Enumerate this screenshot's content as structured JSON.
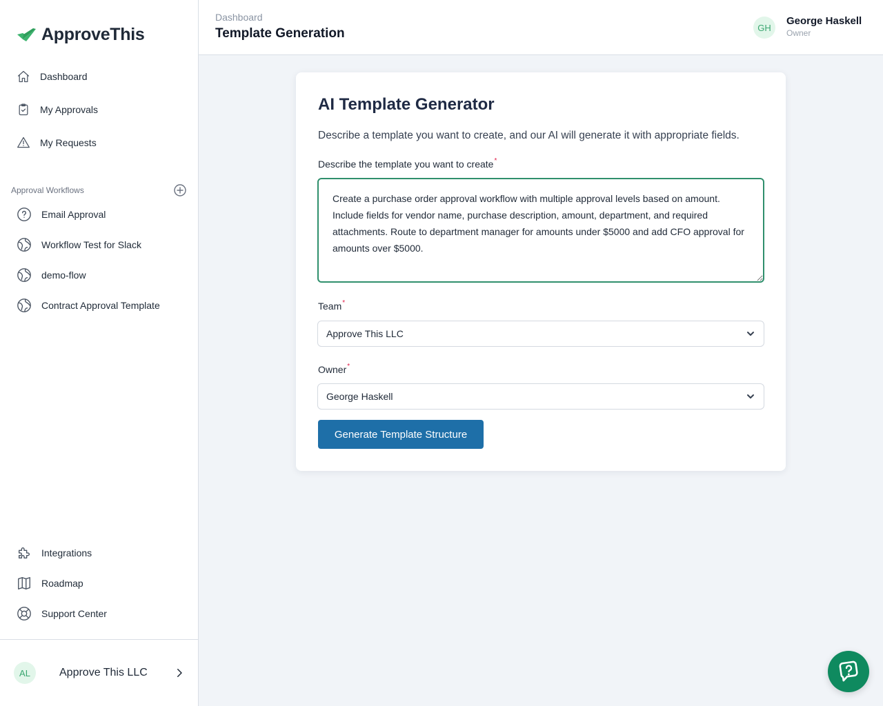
{
  "app": {
    "name": "ApproveThis",
    "brand_color": "#3cb46e",
    "accent_color": "#1e6fa8"
  },
  "sidebar": {
    "main_nav": [
      {
        "label": "Dashboard",
        "icon": "home-icon"
      },
      {
        "label": "My Approvals",
        "icon": "clipboard-check-icon"
      },
      {
        "label": "My Requests",
        "icon": "warning-triangle-icon"
      }
    ],
    "workflows_title": "Approval Workflows",
    "workflows": [
      {
        "label": "Email Approval",
        "icon": "question-circle-icon"
      },
      {
        "label": "Workflow Test for Slack",
        "icon": "globe-icon"
      },
      {
        "label": "demo-flow",
        "icon": "globe-icon"
      },
      {
        "label": "Contract Approval Template",
        "icon": "globe-icon"
      }
    ],
    "bottom_nav": [
      {
        "label": "Integrations",
        "icon": "puzzle-icon"
      },
      {
        "label": "Roadmap",
        "icon": "map-icon"
      },
      {
        "label": "Support Center",
        "icon": "lifebuoy-icon"
      }
    ],
    "org": {
      "initials": "AL",
      "name": "Approve This LLC"
    }
  },
  "header": {
    "breadcrumb": "Dashboard",
    "title": "Template Generation",
    "user": {
      "initials": "GH",
      "name": "George Haskell",
      "role": "Owner"
    }
  },
  "form": {
    "title": "AI Template Generator",
    "description": "Describe a template you want to create, and our AI will generate it with appropriate fields.",
    "prompt_label": "Describe the template you want to create",
    "prompt_value": "Create a purchase order approval workflow with multiple approval levels based on amount. Include fields for vendor name, purchase description, amount, department, and required attachments. Route to department manager for amounts under $5000 and add CFO approval for amounts over $5000.",
    "required_mark": "*",
    "team_label": "Team",
    "team_value": "Approve This LLC",
    "owner_label": "Owner",
    "owner_value": "George Haskell",
    "submit_label": "Generate Template Structure"
  },
  "help_widget": {
    "icon": "help-chat-icon"
  }
}
